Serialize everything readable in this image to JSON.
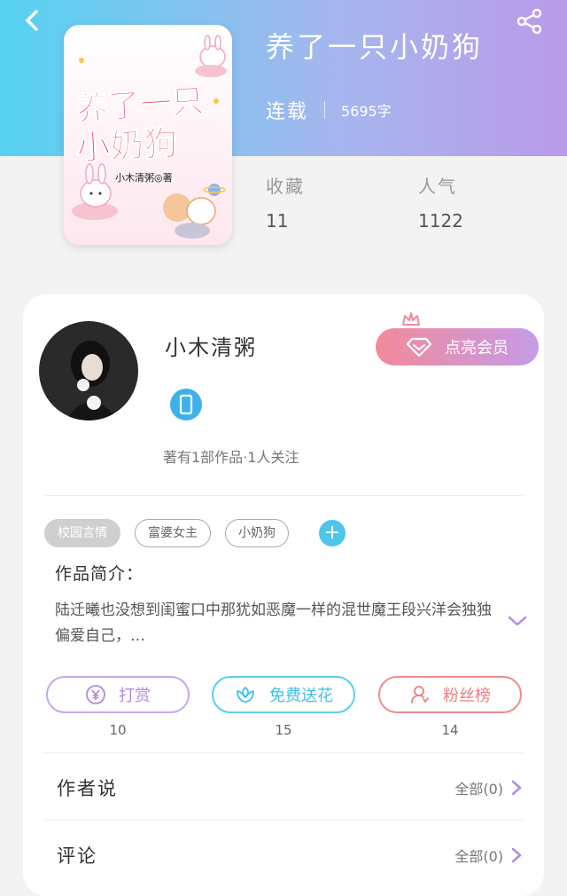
{
  "header": {
    "back_icon": "back-arrow-icon",
    "share_icon": "share-icon",
    "gradient": [
      "#56d2f1",
      "#b99ae9"
    ]
  },
  "book": {
    "title": "养了一只小奶狗",
    "status": "连载",
    "word_count": "5695字",
    "cover": {
      "title_line1": "养了一只",
      "title_line2": "小奶狗",
      "author_credit": "小木清粥◎著"
    }
  },
  "stats": [
    {
      "label": "收藏",
      "value": "11"
    },
    {
      "label": "人气",
      "value": "1122"
    }
  ],
  "author": {
    "name": "小木清粥",
    "works_info": "著有1部作品·1人关注",
    "vip_button": "点亮会员"
  },
  "tags": [
    {
      "label": "校园言情",
      "style": "filled"
    },
    {
      "label": "富婆女主",
      "style": "outline"
    },
    {
      "label": "小奶狗",
      "style": "outline"
    }
  ],
  "intro": {
    "label": "作品简介：",
    "text": "陆迁曦也没想到闺蜜口中那犹如恶魔一样的混世魔王段兴洋会独独偏爱自己，…"
  },
  "actions": [
    {
      "label": "打赏",
      "count": "10",
      "icon": "yen-icon",
      "color": "#b38ae0"
    },
    {
      "label": "免费送花",
      "count": "15",
      "icon": "flower-icon",
      "color": "#3ec1e6"
    },
    {
      "label": "粉丝榜",
      "count": "14",
      "icon": "user-icon",
      "color": "#ef7d7d"
    }
  ],
  "sections": [
    {
      "title": "作者说",
      "link": "全部(0)"
    },
    {
      "title": "评论",
      "link": "全部(0)"
    }
  ]
}
